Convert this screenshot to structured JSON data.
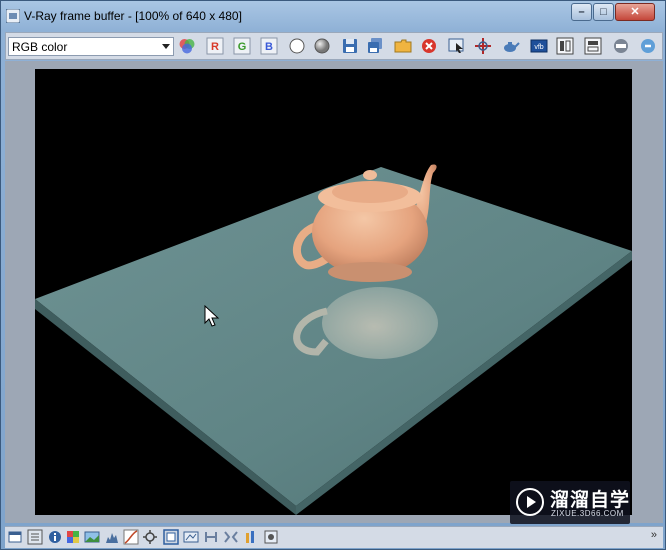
{
  "window": {
    "title": "V-Ray frame buffer - [100% of 640 x 480]",
    "controls": {
      "minimize": "–",
      "maximize": "□",
      "close": "✕"
    }
  },
  "toolbar": {
    "channel_select": {
      "value": "RGB color"
    },
    "buttons": [
      {
        "name": "colors-icon"
      },
      {
        "name": "red-channel-button",
        "letter": "R",
        "color": "#d83a2a"
      },
      {
        "name": "green-channel-button",
        "letter": "G",
        "color": "#3a9a2a"
      },
      {
        "name": "blue-channel-button",
        "letter": "B",
        "color": "#3a5ad8"
      },
      {
        "name": "white-display-button"
      },
      {
        "name": "mono-display-button"
      },
      {
        "name": "save-image-button"
      },
      {
        "name": "save-all-button"
      },
      {
        "name": "load-image-button"
      },
      {
        "name": "clear-image-button"
      },
      {
        "name": "track-mouse-button"
      },
      {
        "name": "region-render-button"
      },
      {
        "name": "render-last-button"
      },
      {
        "name": "lens-effects-button"
      },
      {
        "name": "compare-a-button"
      },
      {
        "name": "compare-b-button"
      },
      {
        "name": "render-button"
      },
      {
        "name": "stop-button"
      }
    ]
  },
  "statusbar": {
    "expand_label": "»",
    "icons": [
      "sb-window-icon",
      "sb-history-icon",
      "sb-info-icon",
      "sb-color-picker-icon",
      "sb-image-icon",
      "sb-levels-icon",
      "sb-curves-icon",
      "sb-exposure-icon",
      "sb-frame-icon",
      "sb-lut-icon",
      "sb-hsv-icon",
      "sb-linked-icon",
      "sb-bars-icon",
      "sb-settings-icon"
    ]
  },
  "watermark": {
    "name": "溜溜自学",
    "url": "ZIXUE.3D66.COM"
  }
}
